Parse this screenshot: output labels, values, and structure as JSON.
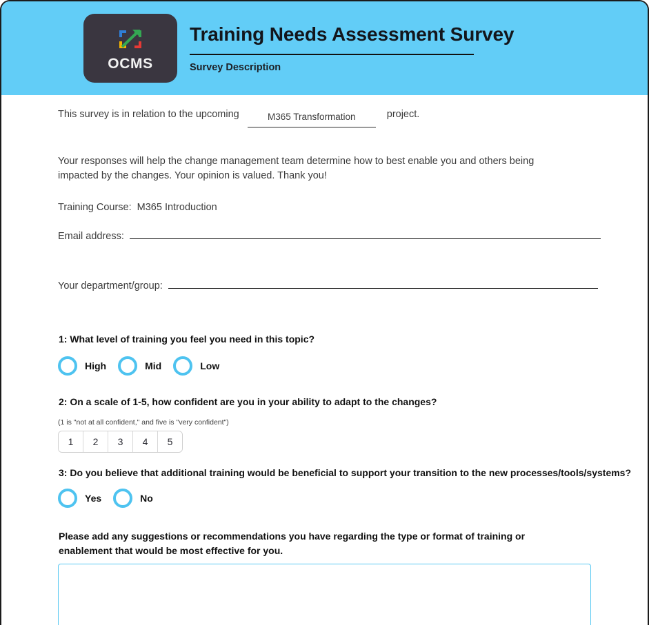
{
  "header": {
    "logo": {
      "name": "ocms-logo",
      "wordmark": "OCMS",
      "icon_name": "expand-arrow-brackets-icon",
      "tile_color": "#3a3640",
      "colors": {
        "top_left": "#2f7fd6",
        "top_right": "#34a853",
        "bottom_right": "#e53935",
        "bottom_left": "#f5b300"
      }
    },
    "title": "Training Needs Assessment Survey",
    "subtitle": "Survey Description",
    "banner_color": "#62cdf7"
  },
  "intro": {
    "lead_text": "This survey is in relation to the upcoming",
    "project_field_value": "M365 Transformation",
    "project_field_placeholder": "",
    "tail_text": "project.",
    "paragraph": "Your responses will help the change management team determine how to best enable you and others being impacted by the changes. Your opinion is valued. Thank you!",
    "course_label": "Training Course:",
    "course_value": "M365 Introduction"
  },
  "fields": [
    {
      "name": "email-field",
      "label": "Email address:",
      "value": "",
      "placeholder": ""
    },
    {
      "name": "department-field",
      "label": "Your department/group:",
      "value": "",
      "placeholder": ""
    }
  ],
  "questions": {
    "q1": {
      "text": "1: What level of training you feel you need in this topic?",
      "options": [
        {
          "label": "High",
          "selected": false
        },
        {
          "label": "Mid",
          "selected": false
        },
        {
          "label": "Low",
          "selected": false
        }
      ]
    },
    "q2": {
      "text": "2: On a scale of 1-5, how confident are you in your ability to adapt to the changes?",
      "hint": "(1 is \"not at all confident,\" and five is \"very confident\")",
      "scale": [
        "1",
        "2",
        "3",
        "4",
        "5"
      ],
      "selected": null
    },
    "q3": {
      "text": "3: Do you believe that additional training would be beneficial to support your transition to the new processes/tools/systems?",
      "options": [
        {
          "label": "Yes",
          "selected": false
        },
        {
          "label": "No",
          "selected": false
        }
      ]
    }
  },
  "comments": {
    "prompt": "Please add any suggestions or recommendations you have regarding the type or format of training or enablement that would be most effective for you.",
    "value": "",
    "placeholder": "",
    "border_color": "#59c8f2"
  },
  "theme": {
    "accent": "#4ec3f0",
    "banner": "#62cdf7",
    "text": "#3b3b3b",
    "heading": "#111111"
  }
}
